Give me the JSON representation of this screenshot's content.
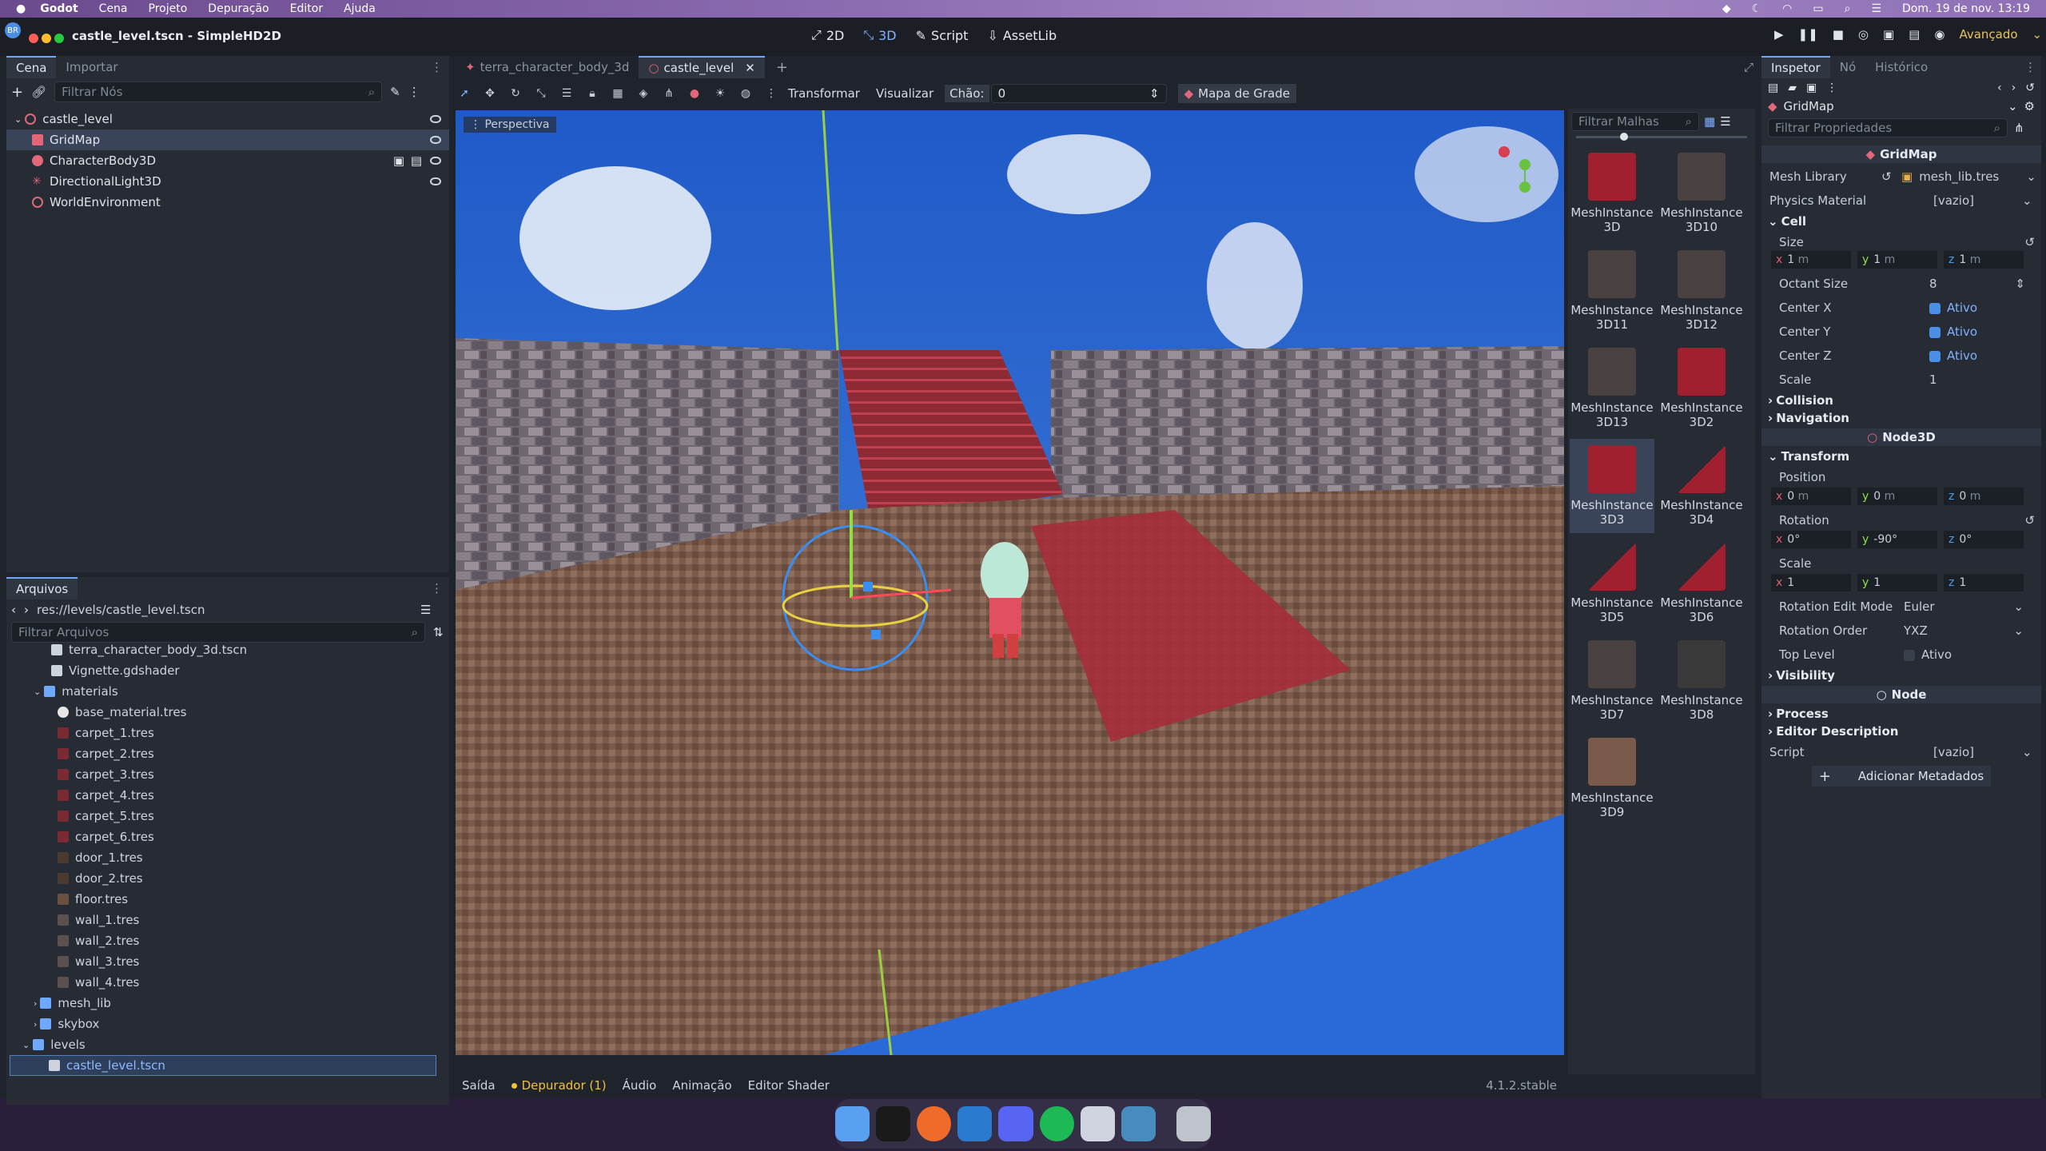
{
  "menubar": {
    "items": [
      "Godot",
      "Cena",
      "Projeto",
      "Depuração",
      "Editor",
      "Ajuda"
    ],
    "clock": "Dom. 19 de nov. 13:19"
  },
  "window": {
    "title": "castle_level.tscn - SimpleHD2D",
    "avatar": "BR",
    "modes": [
      "2D",
      "3D",
      "Script",
      "AssetLib"
    ],
    "advanced": "Avançado"
  },
  "scene_panel": {
    "tabs": [
      "Cena",
      "Importar"
    ],
    "filter_placeholder": "Filtrar Nós",
    "nodes": [
      "castle_level",
      "GridMap",
      "CharacterBody3D",
      "DirectionalLight3D",
      "WorldEnvironment"
    ]
  },
  "filesystem": {
    "title": "Arquivos",
    "path": "res://levels/castle_level.tscn",
    "filter_placeholder": "Filtrar Arquivos",
    "items": [
      "terra_character_body_3d.tscn",
      "Vignette.gdshader",
      "materials",
      "base_material.tres",
      "carpet_1.tres",
      "carpet_2.tres",
      "carpet_3.tres",
      "carpet_4.tres",
      "carpet_5.tres",
      "carpet_6.tres",
      "door_1.tres",
      "door_2.tres",
      "floor.tres",
      "wall_1.tres",
      "wall_2.tres",
      "wall_3.tres",
      "wall_4.tres",
      "mesh_lib",
      "skybox",
      "levels",
      "castle_level.tscn"
    ]
  },
  "editor_tabs": [
    "terra_character_body_3d",
    "castle_level"
  ],
  "viewport_toolbar": {
    "transform": "Transformar",
    "view": "Visualizar",
    "floor_label": "Chão:",
    "floor_value": "0",
    "gridmap_button": "Mapa de Grade",
    "perspective": "Perspectiva"
  },
  "mesh_palette": {
    "filter_placeholder": "Filtrar Malhas",
    "items": [
      "MeshInstance3D",
      "MeshInstance3D10",
      "MeshInstance3D11",
      "MeshInstance3D12",
      "MeshInstance3D13",
      "MeshInstance3D2",
      "MeshInstance3D3",
      "MeshInstance3D4",
      "MeshInstance3D5",
      "MeshInstance3D6",
      "MeshInstance3D7",
      "MeshInstance3D8",
      "MeshInstance3D9"
    ],
    "labels": [
      [
        "MeshInstance",
        "3D"
      ],
      [
        "MeshInstance",
        "3D10"
      ],
      [
        "MeshInstance",
        "3D11"
      ],
      [
        "MeshInstance",
        "3D12"
      ],
      [
        "MeshInstance",
        "3D13"
      ],
      [
        "MeshInstance",
        "3D2"
      ],
      [
        "MeshInstance",
        "3D3"
      ],
      [
        "MeshInstance",
        "3D4"
      ],
      [
        "MeshInstance",
        "3D5"
      ],
      [
        "MeshInstance",
        "3D6"
      ],
      [
        "MeshInstance",
        "3D7"
      ],
      [
        "MeshInstance",
        "3D8"
      ],
      [
        "MeshInstance",
        "3D9"
      ]
    ]
  },
  "inspector": {
    "tabs": [
      "Inspetor",
      "Nó",
      "Histórico"
    ],
    "node_name": "GridMap",
    "filter_placeholder": "Filtrar Propriedades",
    "section_gridmap": "GridMap",
    "mesh_library_label": "Mesh Library",
    "mesh_library_value": "mesh_lib.tres",
    "physics_material_label": "Physics Material",
    "physics_material_value": "[vazio]",
    "cell_group": "Cell",
    "size_label": "Size",
    "size": {
      "x": "1",
      "y": "1",
      "z": "1",
      "unit": "m"
    },
    "octant_label": "Octant Size",
    "octant_value": "8",
    "center_x_label": "Center X",
    "center_y_label": "Center Y",
    "center_z_label": "Center Z",
    "ativo": "Ativo",
    "scale_label": "Scale",
    "scale_value": "1",
    "collision": "Collision",
    "navigation": "Navigation",
    "section_node3d": "Node3D",
    "transform_group": "Transform",
    "position_label": "Position",
    "position": {
      "x": "0",
      "y": "0",
      "z": "0",
      "unit": "m"
    },
    "rotation_label": "Rotation",
    "rotation": {
      "x": "0",
      "y": "-90",
      "z": "0",
      "unit": "°"
    },
    "tscale_label": "Scale",
    "tscale": {
      "x": "1",
      "y": "1",
      "z": "1"
    },
    "rot_edit_label": "Rotation Edit Mode",
    "rot_edit_value": "Euler",
    "rot_order_label": "Rotation Order",
    "rot_order_value": "YXZ",
    "top_level_label": "Top Level",
    "visibility": "Visibility",
    "section_node": "Node",
    "process": "Process",
    "editor_description": "Editor Description",
    "script_label": "Script",
    "script_value": "[vazio]",
    "add_metadata": "Adicionar Metadados"
  },
  "bottom_panel": {
    "tabs": [
      "Saída",
      "Depurador (1)",
      "Áudio",
      "Animação",
      "Editor Shader"
    ],
    "version": "4.1.2.stable"
  },
  "colors": {
    "accent": "#6ea8ff",
    "selected": "#3a4458",
    "panel": "#262b34",
    "warning_dot": "#f0c040"
  }
}
